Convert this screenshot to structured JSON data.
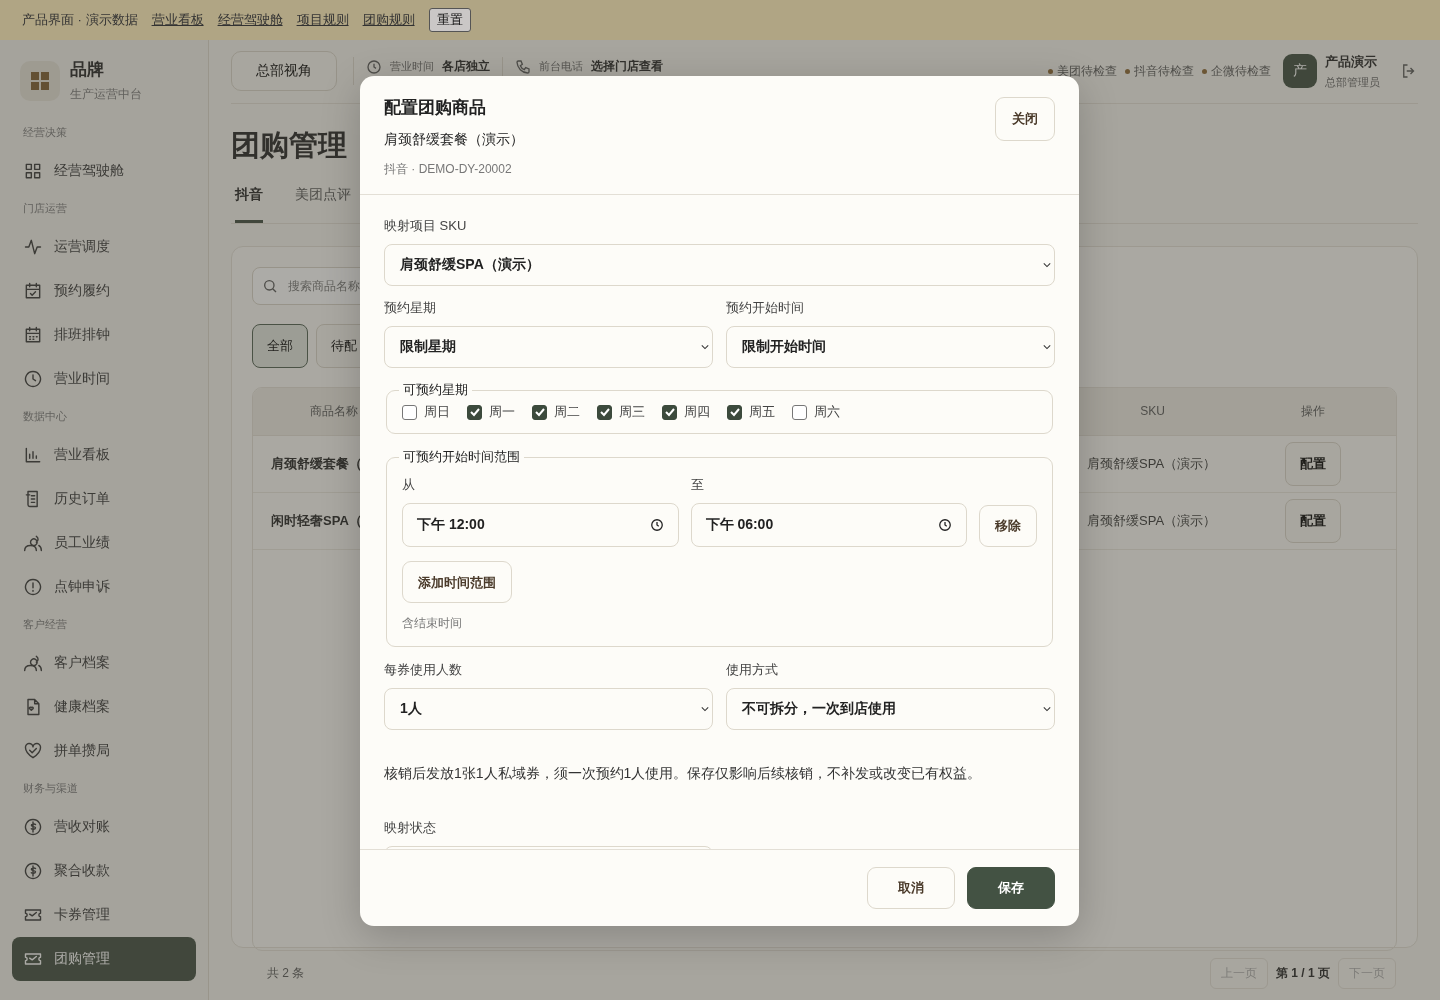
{
  "banner": {
    "title": "产品界面 · 演示数据",
    "links": [
      "营业看板",
      "经营驾驶舱",
      "项目规则",
      "团购规则"
    ],
    "reset": "重置"
  },
  "sidebar": {
    "brand": "品牌",
    "subtitle": "生产运营中台",
    "sections": [
      {
        "title": "经营决策",
        "items": [
          {
            "label": "经营驾驶舱",
            "selected": false
          }
        ]
      },
      {
        "title": "门店运营",
        "items": [
          {
            "label": "运营调度",
            "selected": false
          },
          {
            "label": "预约履约",
            "selected": false
          },
          {
            "label": "排班排钟",
            "selected": false
          },
          {
            "label": "营业时间",
            "selected": false
          }
        ]
      },
      {
        "title": "数据中心",
        "items": [
          {
            "label": "营业看板",
            "selected": false
          },
          {
            "label": "历史订单",
            "selected": false
          },
          {
            "label": "员工业绩",
            "selected": false
          },
          {
            "label": "点钟申诉",
            "selected": false
          }
        ]
      },
      {
        "title": "客户经营",
        "items": [
          {
            "label": "客户档案",
            "selected": false
          },
          {
            "label": "健康档案",
            "selected": false
          },
          {
            "label": "拼单攒局",
            "selected": false
          }
        ]
      },
      {
        "title": "财务与渠道",
        "items": [
          {
            "label": "营收对账",
            "selected": false
          },
          {
            "label": "聚合收款",
            "selected": false
          },
          {
            "label": "卡券管理",
            "selected": false
          },
          {
            "label": "团购管理",
            "selected": true
          }
        ]
      }
    ]
  },
  "header": {
    "view_button": "总部视角",
    "hours_label": "营业时间",
    "hours_value": "各店独立",
    "phone_label": "前台电话",
    "phone_value": "选择门店查看",
    "checks": [
      "美团待检查",
      "抖音待检查",
      "企微待检查"
    ],
    "user": {
      "avatar": "产",
      "name": "产品演示",
      "role": "总部管理员"
    }
  },
  "page": {
    "title": "团购管理",
    "tabs": [
      {
        "label": "抖音",
        "selected": true
      },
      {
        "label": "美团点评",
        "selected": false
      }
    ],
    "search": {
      "placeholder": "搜索商品名称"
    },
    "filters": [
      {
        "label": "全部",
        "selected": true
      },
      {
        "label": "待配",
        "selected": false
      }
    ],
    "table": {
      "columns": [
        "商品名称",
        "SKU",
        "操作"
      ],
      "rows": [
        {
          "name": "肩颈舒缓套餐（",
          "sku": "肩颈舒缓SPA（演示）",
          "action": "配置"
        },
        {
          "name": "闲时轻奢SPA（",
          "sku": "肩颈舒缓SPA（演示）",
          "action": "配置"
        }
      ]
    },
    "total": "共 2 条",
    "pager": {
      "prev": {
        "label": "上一页",
        "disabled": true
      },
      "page": "第 1 / 1 页",
      "next": {
        "label": "下一页",
        "disabled": true
      }
    }
  },
  "modal": {
    "title": "配置团购商品",
    "subtitle": "肩颈舒缓套餐（演示）",
    "meta": "抖音 · DEMO-DY-20002",
    "close": "关闭",
    "sku": {
      "label": "映射项目 SKU",
      "value": "肩颈舒缓SPA（演示）"
    },
    "weekday_mode": {
      "label": "预约星期",
      "value": "限制星期"
    },
    "start_mode": {
      "label": "预约开始时间",
      "value": "限制开始时间"
    },
    "weekdays": {
      "legend": "可预约星期",
      "days": [
        {
          "label": "周日",
          "checked": false
        },
        {
          "label": "周一",
          "checked": true
        },
        {
          "label": "周二",
          "checked": true
        },
        {
          "label": "周三",
          "checked": true
        },
        {
          "label": "周四",
          "checked": true
        },
        {
          "label": "周五",
          "checked": true
        },
        {
          "label": "周六",
          "checked": false
        }
      ]
    },
    "time_ranges": {
      "legend": "可预约开始时间范围",
      "from_label": "从",
      "to_label": "至",
      "ranges": [
        {
          "from": "下午 12:00",
          "to": "下午 06:00",
          "remove": "移除"
        }
      ],
      "add": "添加时间范围",
      "hint": "含结束时间"
    },
    "people": {
      "label": "每券使用人数",
      "value": "1人"
    },
    "usage": {
      "label": "使用方式",
      "value": "不可拆分，一次到店使用"
    },
    "note": "核销后发放1张1人私域券，须一次预约1人使用。保存仅影响后续核销，不补发或改变已有权益。",
    "status": {
      "label": "映射状态"
    },
    "cancel": "取消",
    "save": "保存"
  }
}
